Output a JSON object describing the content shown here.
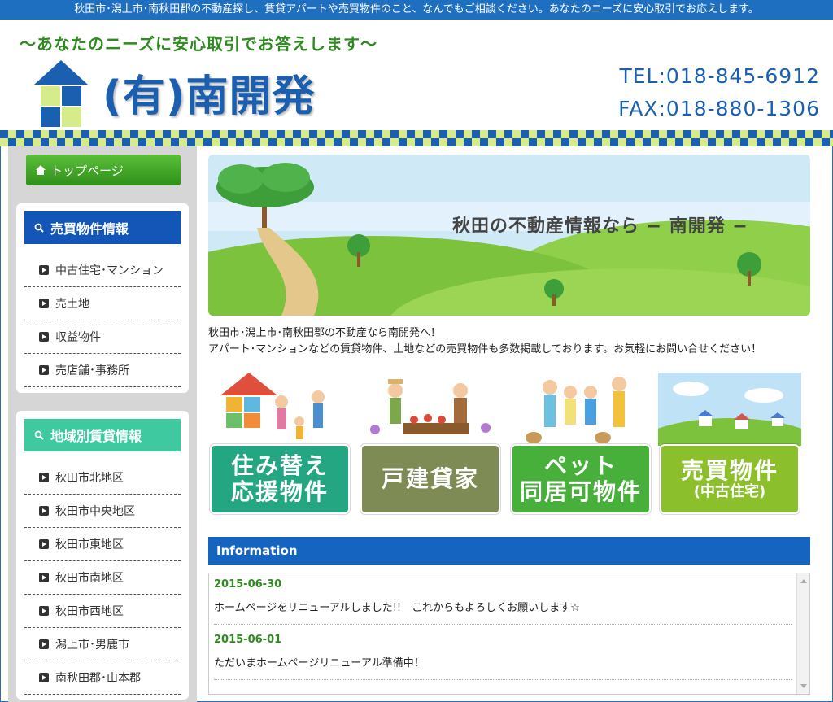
{
  "topbar": {
    "text": "秋田市･潟上市･南秋田郡の不動産探し、賃貸アパートや売買物件のこと、なんでもご相談ください。あなたのニーズに安心取引でお応えします。"
  },
  "header": {
    "tagline": "〜あなたのニーズに安心取引でお答えします〜",
    "company": "(有)南開発",
    "tel": "TEL:018-845-6912",
    "fax": "FAX:018-880-1306"
  },
  "sidebar": {
    "top_label": "トップページ",
    "sale": {
      "title": "売買物件情報",
      "items": [
        "中古住宅･マンション",
        "売土地",
        "収益物件",
        "売店舗･事務所"
      ]
    },
    "rent": {
      "title": "地域別賃貸情報",
      "items": [
        "秋田市北地区",
        "秋田市中央地区",
        "秋田市東地区",
        "秋田市南地区",
        "秋田市西地区",
        "潟上市･男鹿市",
        "南秋田郡･山本郡"
      ]
    }
  },
  "banner": {
    "title": "秋田の不動産情報なら − 南開発 −"
  },
  "intro": {
    "line1": "秋田市･潟上市･南秋田郡の不動産なら南開発へ！",
    "line2": "アパート･マンションなどの賃貸物件、土地などの売買物件も多数掲載しております。お気軽にお問い合せください！"
  },
  "tiles": [
    {
      "line1": "住み替え",
      "line2": "応援物件"
    },
    {
      "line1": "戸建貸家",
      "line2": ""
    },
    {
      "line1": "ペット",
      "line2": "同居可物件"
    },
    {
      "line1": "売買物件",
      "line2": "(中古住宅)"
    }
  ],
  "information": {
    "title": "Information",
    "items": [
      {
        "date": "2015-06-30",
        "text": "ホームページをリニューアルしました!!　これからもよろしくお願いします☆"
      },
      {
        "date": "2015-06-01",
        "text": "ただいまホームページリニューアル準備中！"
      }
    ]
  },
  "colors": {
    "brand_blue": "#1b5fb0",
    "green": "#2e8b1f",
    "teal": "#3ec9a0"
  }
}
